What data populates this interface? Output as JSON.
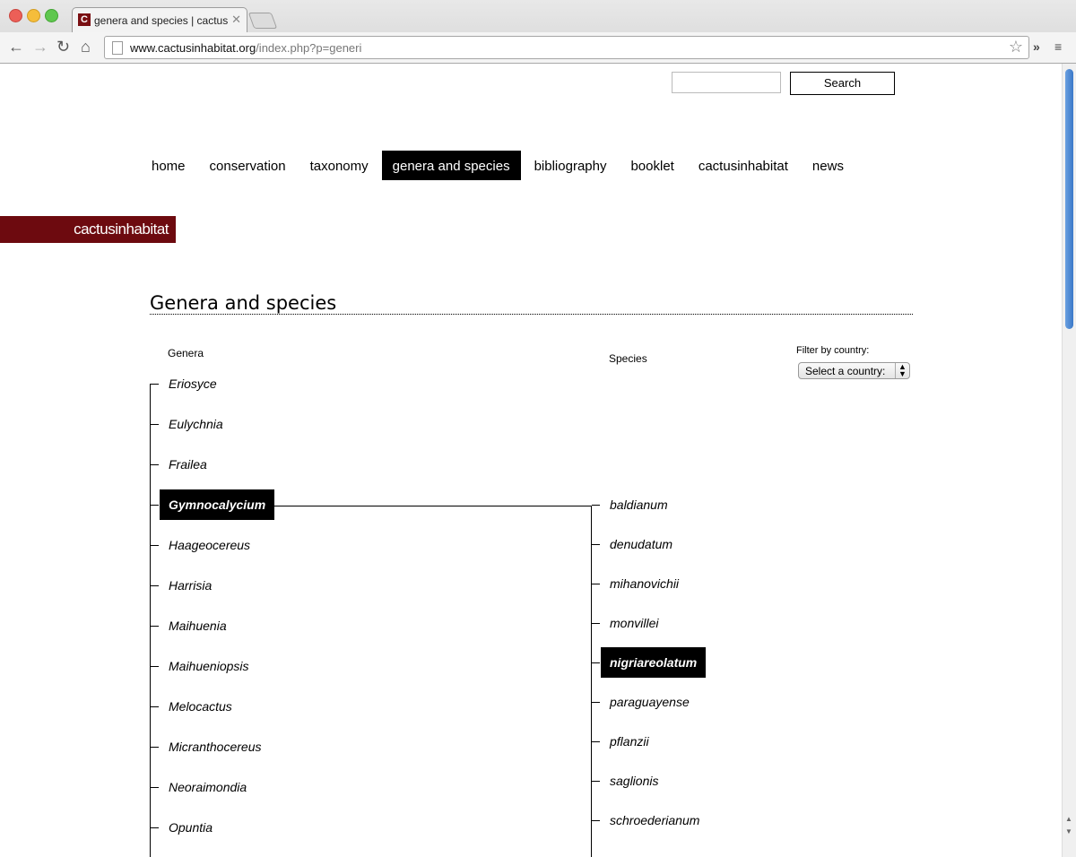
{
  "browser": {
    "tab_title": "genera and species | cactusinhabitat",
    "favicon": "C",
    "url_host": "www.cactusinhabitat.org",
    "url_path": "/index.php?p=generi"
  },
  "search": {
    "placeholder": "",
    "button_label": "Search"
  },
  "nav": [
    {
      "label": "home"
    },
    {
      "label": "conservation"
    },
    {
      "label": "taxonomy"
    },
    {
      "label": "genera and species",
      "active": true
    },
    {
      "label": "bibliography"
    },
    {
      "label": "booklet"
    },
    {
      "label": "cactusinhabitat"
    },
    {
      "label": "news"
    }
  ],
  "brand": {
    "label": "cactusinhabitat",
    "color": "#6d0a0f"
  },
  "page": {
    "title": "Genera and species",
    "genera_heading": "Genera",
    "species_heading": "Species"
  },
  "filter": {
    "label": "Filter by country:",
    "selected": "Select a country:"
  },
  "genera": [
    "Eriosyce",
    "Eulychnia",
    "Frailea",
    "Gymnocalycium",
    "Haageocereus",
    "Harrisia",
    "Maihuenia",
    "Maihueniopsis",
    "Melocactus",
    "Micranthocereus",
    "Neoraimondia",
    "Opuntia"
  ],
  "selected_genus": "Gymnocalycium",
  "species": [
    "baldianum",
    "denudatum",
    "mihanovichii",
    "monvillei",
    "nigriareolatum",
    "paraguayense",
    "pflanzii",
    "saglionis",
    "schroederianum"
  ],
  "selected_species": "nigriareolatum"
}
